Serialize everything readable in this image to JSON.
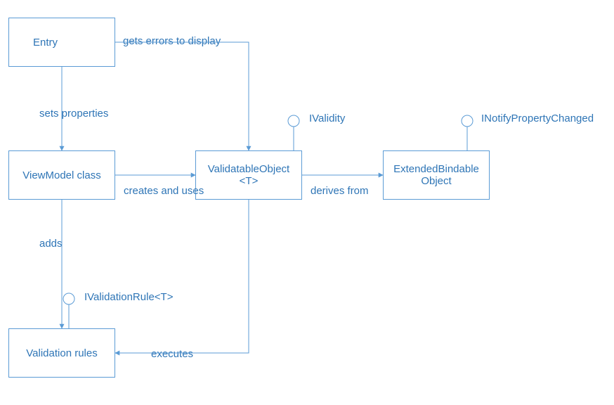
{
  "boxes": {
    "entry": "Entry",
    "viewmodel": "ViewModel class",
    "validatable": "ValidatableObject\n<T>",
    "extended": "ExtendedBindable\nObject",
    "rules": "Validation rules"
  },
  "edges": {
    "gets_errors": "gets errors to display",
    "sets_properties": "sets properties",
    "creates_uses": "creates and uses",
    "derives_from": "derives from",
    "adds": "adds",
    "executes": "executes"
  },
  "interfaces": {
    "ivalidity": "IValidity",
    "inotify": "INotifyPropertyChanged",
    "ivalidationrule": "IValidationRule<T>"
  }
}
